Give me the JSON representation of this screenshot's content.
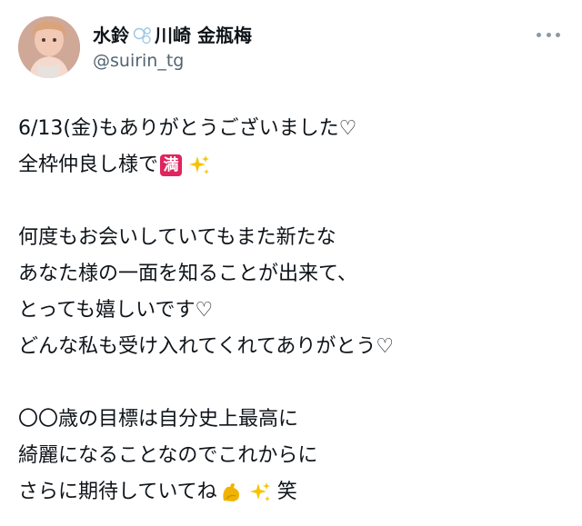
{
  "post": {
    "display_name_part1": "水鈴",
    "display_name_part2": "川崎 金瓶梅",
    "handle": "@suirin_tg",
    "lines": [
      "6/13(金)もありがとうございました♡",
      "全枠仲良し様で",
      "",
      "何度もお会いしていてもまた新たな",
      "あなた様の一面を知ることが出来て、",
      "とっても嬉しいです♡",
      "どんな私も受け入れてくれてありがとう♡",
      "",
      "〇〇歳の目標は自分史上最高に",
      "綺麗になることなのでこれからに",
      "さらに期待していてね",
      "笑"
    ],
    "emoji_man_char": "満"
  },
  "icons": {
    "bubbles": "bubbles-emoji-icon",
    "man": "full-mark-emoji-icon",
    "sparkles": "sparkles-emoji-icon",
    "arm": "flexed-biceps-emoji-icon",
    "more": "more-options-icon"
  },
  "colors": {
    "text": "#0f1419",
    "handle": "#536471",
    "man_badge": "#e0245e",
    "sparkle": "#f5c400",
    "arm": "#f0b400"
  }
}
